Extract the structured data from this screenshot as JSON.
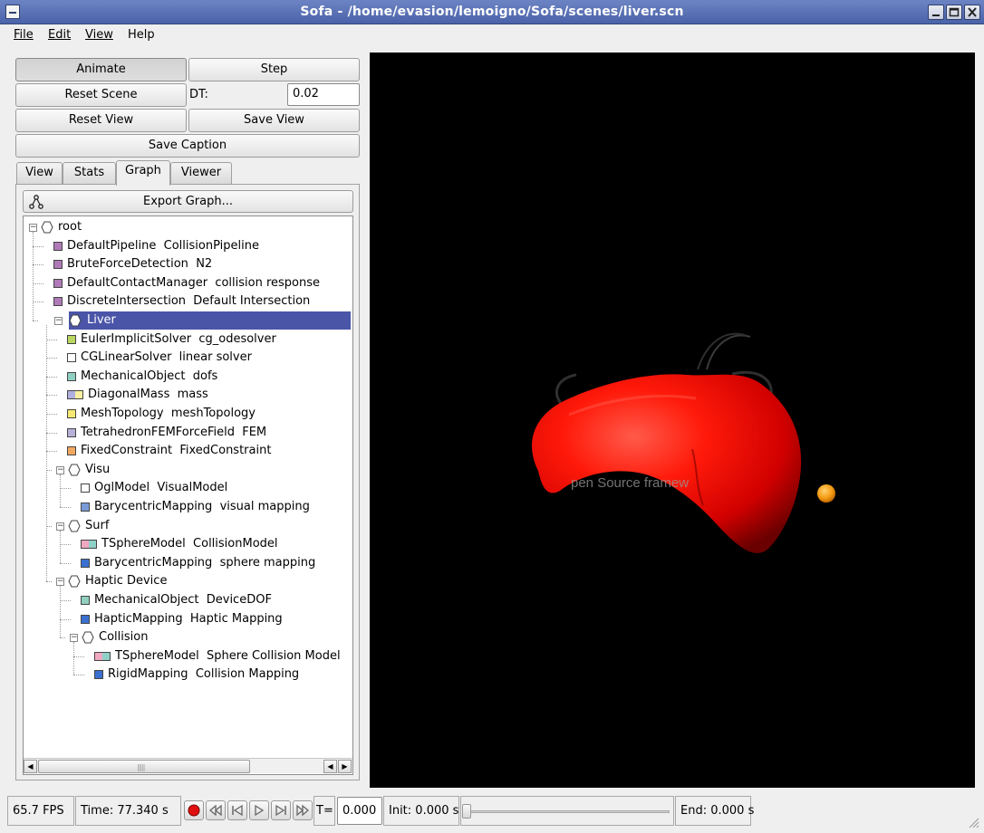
{
  "window": {
    "title": "Sofa - /home/evasion/lemoigno/Sofa/scenes/liver.scn"
  },
  "menu": [
    "File",
    "Edit",
    "View",
    "Help"
  ],
  "controls": {
    "animate": "Animate",
    "step": "Step",
    "reset_scene": "Reset Scene",
    "dt_label": "DT:",
    "dt_value": "0.02",
    "reset_view": "Reset View",
    "save_view": "Save View",
    "save_caption": "Save Caption"
  },
  "tabs": [
    "View",
    "Stats",
    "Graph",
    "Viewer"
  ],
  "active_tab": "Graph",
  "export_graph": "Export Graph...",
  "tree": [
    {
      "label": "root",
      "kind": "node",
      "depth": 0
    },
    {
      "label": "DefaultPipeline  CollisionPipeline",
      "kind": "obj",
      "color": "#b07ab8",
      "depth": 1
    },
    {
      "label": "BruteForceDetection  N2",
      "kind": "obj",
      "color": "#b07ab8",
      "depth": 1
    },
    {
      "label": "DefaultContactManager  collision response",
      "kind": "obj",
      "color": "#b07ab8",
      "depth": 1
    },
    {
      "label": "DiscreteIntersection  Default Intersection",
      "kind": "obj",
      "color": "#b07ab8",
      "depth": 1
    },
    {
      "label": "Liver",
      "kind": "node",
      "depth": 1,
      "selected": true
    },
    {
      "label": "EulerImplicitSolver  cg_odesolver",
      "kind": "obj",
      "color": "#b8d860",
      "depth": 2
    },
    {
      "label": "CGLinearSolver  linear solver",
      "kind": "obj",
      "color": "#ffffff",
      "depth": 2
    },
    {
      "label": "MechanicalObject  dofs",
      "kind": "obj",
      "color": "#8fcfc0",
      "depth": 2
    },
    {
      "label": "DiagonalMass  mass",
      "kind": "obj2",
      "color": "#b0b0e0",
      "color2": "#f8f0a0",
      "depth": 2
    },
    {
      "label": "MeshTopology  meshTopology",
      "kind": "obj",
      "color": "#f6e872",
      "depth": 2
    },
    {
      "label": "TetrahedronFEMForceField  FEM",
      "kind": "obj",
      "color": "#b8b0d8",
      "depth": 2
    },
    {
      "label": "FixedConstraint  FixedConstraint",
      "kind": "obj",
      "color": "#f0a860",
      "depth": 2
    },
    {
      "label": "Visu",
      "kind": "node",
      "depth": 2
    },
    {
      "label": "OglModel  VisualModel",
      "kind": "obj",
      "color": "#ffffff",
      "depth": 3
    },
    {
      "label": "BarycentricMapping  visual mapping",
      "kind": "obj",
      "color": "#7a9ad8",
      "depth": 3
    },
    {
      "label": "Surf",
      "kind": "node",
      "depth": 2
    },
    {
      "label": "TSphereModel  CollisionModel",
      "kind": "obj2",
      "color": "#f0a8c0",
      "color2": "#8fd0c8",
      "depth": 3
    },
    {
      "label": "BarycentricMapping  sphere mapping",
      "kind": "obj",
      "color": "#3a70d0",
      "depth": 3
    },
    {
      "label": "Haptic Device",
      "kind": "node",
      "depth": 2
    },
    {
      "label": "MechanicalObject  DeviceDOF",
      "kind": "obj",
      "color": "#8fcfc0",
      "depth": 3
    },
    {
      "label": "HapticMapping  Haptic Mapping",
      "kind": "obj",
      "color": "#3a70d0",
      "depth": 3
    },
    {
      "label": "Collision",
      "kind": "node",
      "depth": 3
    },
    {
      "label": "TSphereModel  Sphere Collision Model",
      "kind": "obj2",
      "color": "#f0a8c0",
      "color2": "#8fd0c8",
      "depth": 4
    },
    {
      "label": "RigidMapping  Collision Mapping",
      "kind": "obj",
      "color": "#3a70d0",
      "depth": 4
    }
  ],
  "viewer": {
    "logo_subtitle": "pen Source framew"
  },
  "status": {
    "fps": "65.7 FPS",
    "time": "Time: 77.340 s",
    "t_label": "T=",
    "t_value": "0.000",
    "init": "Init: 0.000 s",
    "end": "End: 0.000 s"
  }
}
